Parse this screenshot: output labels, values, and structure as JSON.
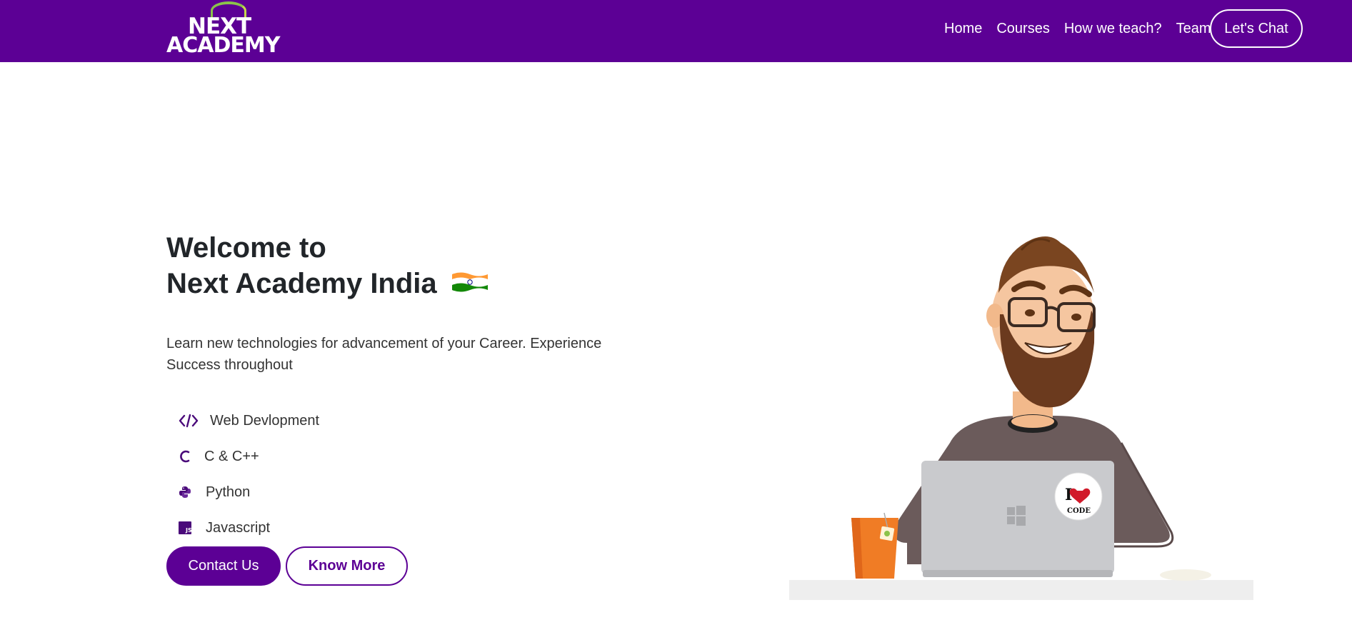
{
  "navbar": {
    "logo_line1": "NEXT",
    "logo_line2": "ACADEMY",
    "links": [
      "Home",
      "Courses",
      "How we teach?",
      "Team"
    ],
    "chat_button": "Let's Chat"
  },
  "hero": {
    "title_line1": "Welcome to",
    "title_line2": "Next Academy India",
    "description": "Learn new technologies for advancement of your Career. Experience Success throughout",
    "topics": [
      {
        "label": "Web Devlopment",
        "icon": "code-icon"
      },
      {
        "label": "C & C++",
        "icon": "c-icon"
      },
      {
        "label": "Python",
        "icon": "python-icon"
      },
      {
        "label": "Javascript",
        "icon": "js-icon"
      }
    ],
    "contact_button": "Contact Us",
    "know_more_button": "Know More"
  },
  "illustration": {
    "sticker_text_line1": "I",
    "sticker_text_line2": "CODE"
  },
  "colors": {
    "brand": "#5c0095",
    "white": "#ffffff"
  }
}
